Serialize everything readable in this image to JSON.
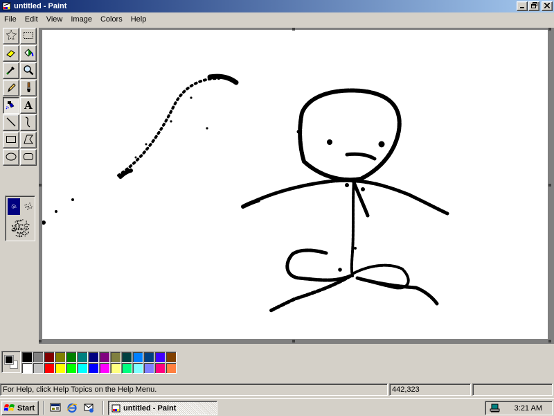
{
  "window": {
    "title": "untitled - Paint",
    "icons": {
      "app": "paint-app-icon",
      "minimize": "minimize-icon",
      "restore": "restore-icon",
      "close": "close-icon"
    }
  },
  "menu": [
    "File",
    "Edit",
    "View",
    "Image",
    "Colors",
    "Help"
  ],
  "tools": [
    {
      "name": "free-form-select-tool",
      "icon": "free-form-select-icon"
    },
    {
      "name": "select-tool",
      "icon": "rectangle-select-icon"
    },
    {
      "name": "eraser-tool",
      "icon": "eraser-icon"
    },
    {
      "name": "fill-with-color-tool",
      "icon": "paint-bucket-icon"
    },
    {
      "name": "pick-color-tool",
      "icon": "eyedropper-icon"
    },
    {
      "name": "magnifier-tool",
      "icon": "magnifier-icon"
    },
    {
      "name": "pencil-tool",
      "icon": "pencil-icon"
    },
    {
      "name": "brush-tool",
      "icon": "brush-icon"
    },
    {
      "name": "airbrush-tool",
      "icon": "airbrush-icon",
      "selected": true
    },
    {
      "name": "text-tool",
      "icon": "text-icon"
    },
    {
      "name": "line-tool",
      "icon": "line-icon"
    },
    {
      "name": "curve-tool",
      "icon": "curve-icon"
    },
    {
      "name": "rectangle-tool",
      "icon": "rectangle-icon"
    },
    {
      "name": "polygon-tool",
      "icon": "polygon-icon"
    },
    {
      "name": "ellipse-tool",
      "icon": "ellipse-icon"
    },
    {
      "name": "rounded-rectangle-tool",
      "icon": "rounded-rectangle-icon"
    }
  ],
  "text_tool_glyph": "A",
  "airbrush_sizes": [
    "small",
    "medium",
    "large"
  ],
  "selected_airbrush_size": "small",
  "colors": {
    "foreground": "#000000",
    "background": "#ffffff",
    "palette": [
      "#000000",
      "#808080",
      "#800000",
      "#808000",
      "#008000",
      "#008080",
      "#000080",
      "#800080",
      "#808040",
      "#004040",
      "#0080ff",
      "#004080",
      "#4000ff",
      "#804000",
      "#ffffff",
      "#c0c0c0",
      "#ff0000",
      "#ffff00",
      "#00ff00",
      "#00ffff",
      "#0000ff",
      "#ff00ff",
      "#ffff80",
      "#00ff80",
      "#80ffff",
      "#8080ff",
      "#ff0080",
      "#ff8040"
    ]
  },
  "status": {
    "help_text": "For Help, click Help Topics on the Help Menu.",
    "coordinates": "442,323"
  },
  "taskbar": {
    "start_label": "Start",
    "quick_launch": [
      "show-desktop-icon",
      "internet-explorer-icon",
      "outlook-express-icon"
    ],
    "task_label": "untitled - Paint",
    "tray_icon": "network-tray-icon",
    "clock": "3:21 AM"
  }
}
